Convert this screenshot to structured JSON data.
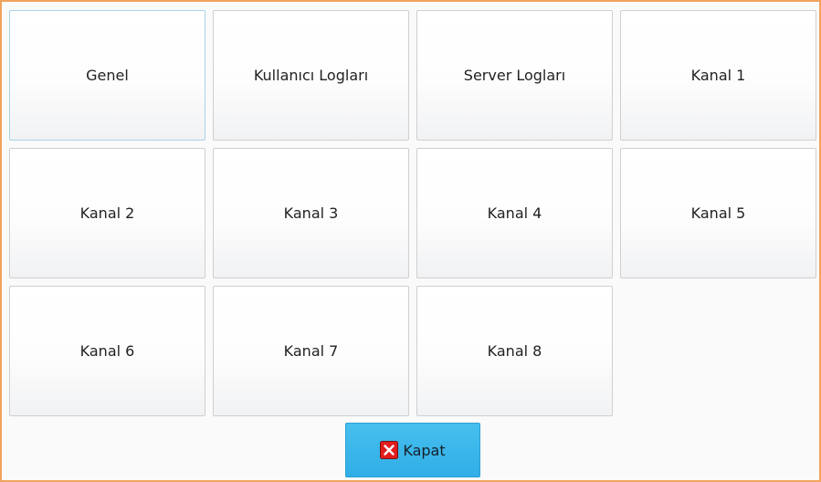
{
  "buttons": [
    {
      "id": "genel",
      "label": "Genel"
    },
    {
      "id": "kullanici-loglari",
      "label": "Kullanıcı Logları"
    },
    {
      "id": "server-loglari",
      "label": "Server Logları"
    },
    {
      "id": "kanal-1",
      "label": "Kanal 1"
    },
    {
      "id": "kanal-2",
      "label": "Kanal 2"
    },
    {
      "id": "kanal-3",
      "label": "Kanal 3"
    },
    {
      "id": "kanal-4",
      "label": "Kanal 4"
    },
    {
      "id": "kanal-5",
      "label": "Kanal 5"
    },
    {
      "id": "kanal-6",
      "label": "Kanal 6"
    },
    {
      "id": "kanal-7",
      "label": "Kanal 7"
    },
    {
      "id": "kanal-8",
      "label": "Kanal 8"
    }
  ],
  "footer": {
    "close_label": "Kapat",
    "close_icon": "close-icon"
  },
  "colors": {
    "window_border": "#f0a35e",
    "close_button": "#35b3e9",
    "close_icon_red": "#e11d1d"
  }
}
